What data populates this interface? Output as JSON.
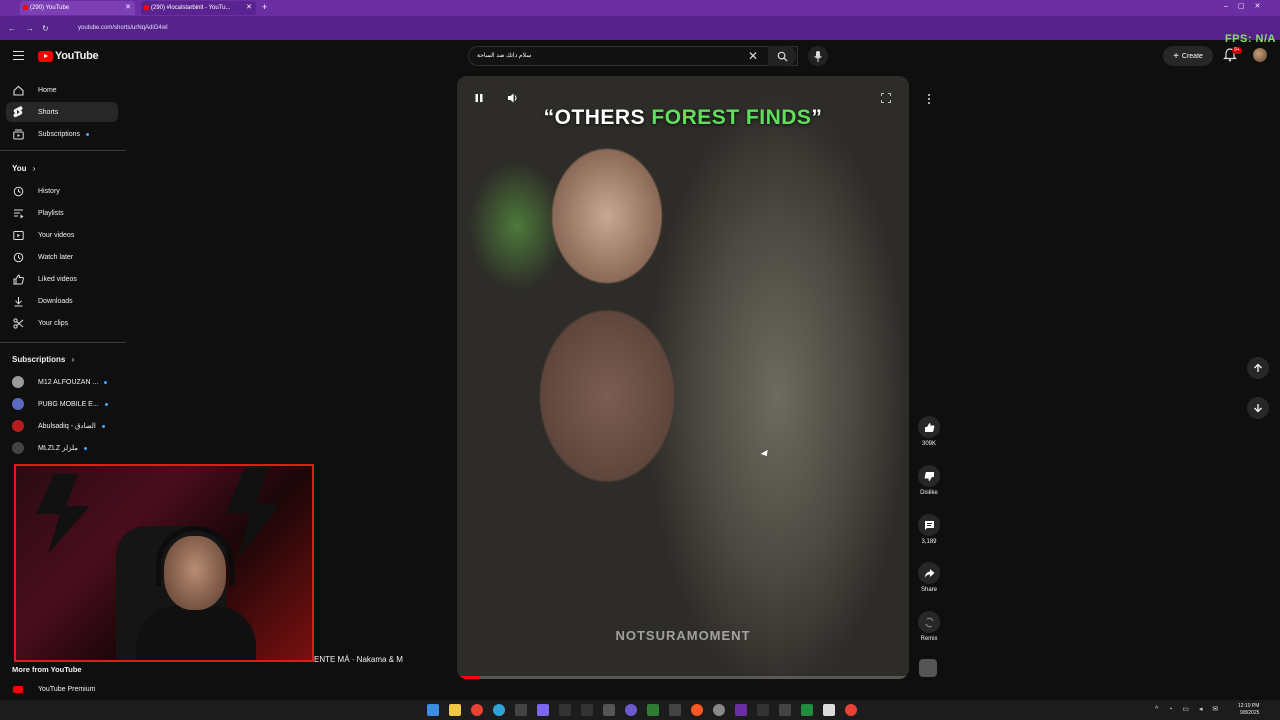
{
  "browser": {
    "tabs": [
      {
        "label": "(290) YouTube"
      },
      {
        "label": "(290) #localstarbinit - YouTu..."
      }
    ],
    "url": "youtube.com/shorts/urNqAdiG4wI",
    "fps_label": "FPS: N/A"
  },
  "header": {
    "logo_text": "YouTube",
    "search_value": "سلام داتك ضد الساحة",
    "create_label": "Create",
    "notif_count": "9+"
  },
  "sidebar": {
    "main": [
      {
        "label": "Home",
        "icon": "home-icon"
      },
      {
        "label": "Shorts",
        "icon": "shorts-icon"
      },
      {
        "label": "Subscriptions",
        "icon": "subscriptions-icon"
      }
    ],
    "you_heading": "You",
    "you_items": [
      {
        "label": "History",
        "icon": "history-icon"
      },
      {
        "label": "Playlists",
        "icon": "playlists-icon"
      },
      {
        "label": "Your videos",
        "icon": "your-videos-icon"
      },
      {
        "label": "Watch later",
        "icon": "clock-icon"
      },
      {
        "label": "Liked videos",
        "icon": "thumbs-up-icon"
      },
      {
        "label": "Downloads",
        "icon": "download-icon"
      },
      {
        "label": "Your clips",
        "icon": "scissors-icon"
      }
    ],
    "subs_heading": "Subscriptions",
    "subscriptions": [
      {
        "label": "M12 ALFOUZAN ...",
        "color": "#9a9a9a"
      },
      {
        "label": "PUBG MOBILE E...",
        "color": "#5c6bc0"
      },
      {
        "label": "Abulsadiq - الصادق",
        "color": "#b71c1c"
      },
      {
        "label": "MLZLZ ملزلز",
        "color": "#444444"
      }
    ],
    "overlay_text": "ENTE MÁ · Nakama & M",
    "more_heading": "More from YouTube",
    "premium_label": "YouTube Premium"
  },
  "video": {
    "caption_white": "“OTHERS ",
    "caption_green": "FOREST FINDS",
    "caption_end": "”",
    "watermark": "NOTSURAMOMENT",
    "progress": 0.05
  },
  "actions": {
    "likes": "309K",
    "dislike_label": "Dislike",
    "comments": "3,189",
    "share_label": "Share",
    "remix_label": "Remix"
  },
  "taskbar": {
    "time": "12:10 PM",
    "date": "9/8/2025"
  },
  "colors": {
    "accent_red": "#ff0000",
    "browser_purple": "#6b2fa3",
    "caption_green": "#5ee05c"
  }
}
